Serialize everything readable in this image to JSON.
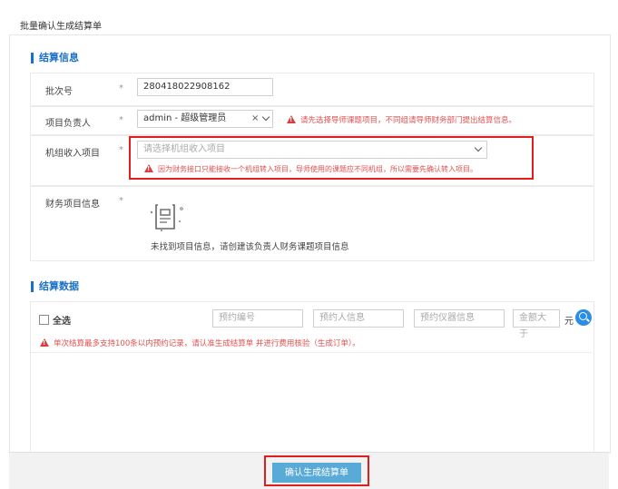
{
  "page": {
    "title": "批量确认生成结算单"
  },
  "settlement_info": {
    "section_title": "结算信息",
    "batch_no_label": "批次号",
    "batch_no_value": "280418022908162",
    "project_leader_label": "项目负责人",
    "project_leader_value": "admin - 超级管理员",
    "project_leader_clear": "×",
    "project_leader_warning": "请先选择导师课题项目，不同组请导师财务部门提出结算信息。",
    "unit_income_label": "机组收入项目",
    "unit_income_placeholder": "请选择机组收入项目",
    "unit_income_warning": "因为财务接口只能接收一个机组转入项目，导师使用的课题应不同机组，所以需要先确认转入项目。",
    "finance_label": "财务项目信息",
    "finance_empty_text": "未找到项目信息，请创建该负责人财务课题项目信息",
    "required_mark": "*"
  },
  "settlement_data": {
    "section_title": "结算数据",
    "select_all_label": "全选",
    "filters": {
      "booking_no_placeholder": "预约编号",
      "booker_placeholder": "预约人信息",
      "instrument_placeholder": "预约仪器信息",
      "amount_placeholder": "金额大于",
      "amount_unit": "元"
    },
    "notice": "单次结算最多支持100条以内预约记录，请认准生成结算单 并进行费用核验（生成订单）。"
  },
  "footer": {
    "confirm_label": "确认生成结算单"
  },
  "colors": {
    "accent": "#1b71c7",
    "warning": "#e05050",
    "highlight": "#e01e1e",
    "button": "#5aaad8"
  }
}
